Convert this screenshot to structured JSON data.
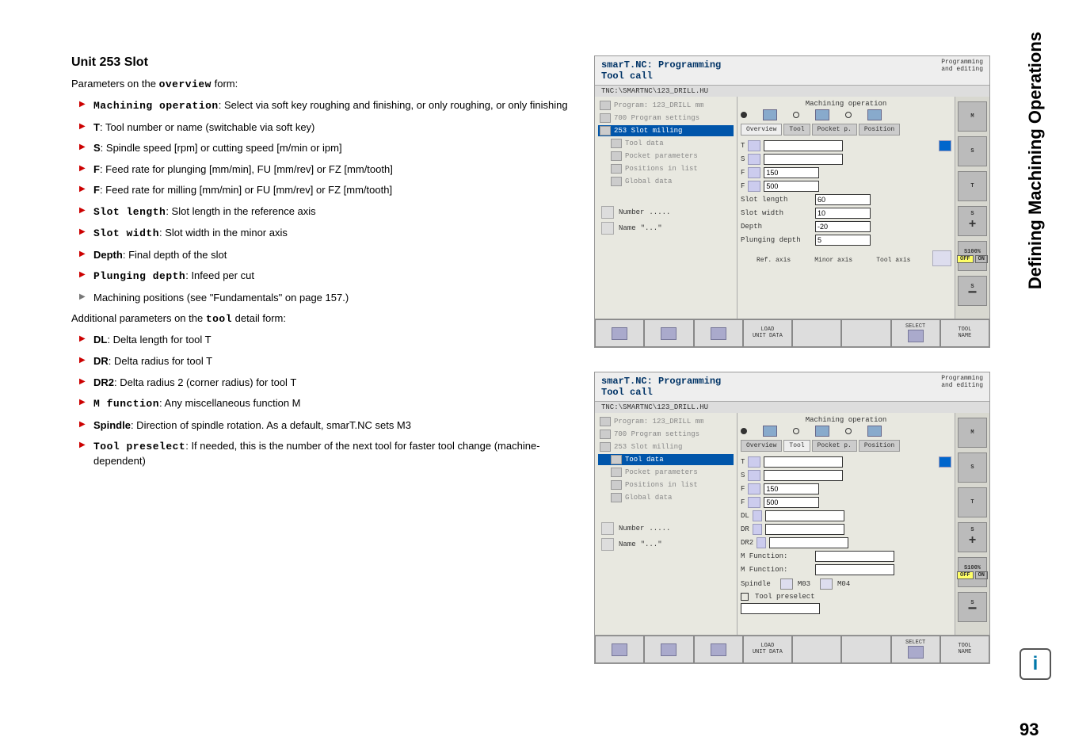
{
  "side_title": "Defining Machining Operations",
  "page_number": "93",
  "heading": "Unit 253 Slot",
  "intro_prefix": "Parameters on the ",
  "intro_bold": "overview",
  "intro_suffix": " form:",
  "params_overview": [
    {
      "bold": "Machining operation",
      "text": ": Select via soft key roughing and finishing, or only roughing, or only finishing",
      "mono": true
    },
    {
      "bold": "T",
      "text": ": Tool number or name (switchable via soft key)"
    },
    {
      "bold": "S",
      "text": ": Spindle speed [rpm] or cutting speed [m/min or ipm]"
    },
    {
      "bold": "F",
      "text": ": Feed rate for plunging [mm/min], FU [mm/rev] or FZ [mm/tooth]"
    },
    {
      "bold": "F",
      "text": ": Feed rate for milling [mm/min] or FU [mm/rev] or FZ [mm/tooth]"
    },
    {
      "bold": "Slot length",
      "text": ": Slot length in the reference axis",
      "mono": true
    },
    {
      "bold": "Slot width",
      "text": ": Slot width in the minor axis",
      "mono": true
    },
    {
      "bold": "Depth",
      "text": ": Final depth of the slot"
    },
    {
      "bold": "Plunging depth",
      "text": ": Infeed per cut",
      "mono": true
    }
  ],
  "param_machining_positions": "Machining positions (see \"Fundamentals\" on page 157.)",
  "intro2_prefix": "Additional parameters on the ",
  "intro2_bold": "tool",
  "intro2_suffix": " detail form:",
  "params_tool": [
    {
      "bold": "DL",
      "text": ": Delta length for tool T"
    },
    {
      "bold": "DR",
      "text": ": Delta radius for tool T"
    },
    {
      "bold": "DR2",
      "text": ": Delta radius 2 (corner radius) for tool T"
    },
    {
      "bold": "M function",
      "text": ": Any miscellaneous function M",
      "mono": true
    },
    {
      "bold": "Spindle",
      "text": ": Direction of spindle rotation. As a default, smarT.NC sets M3"
    },
    {
      "bold": "Tool preselect",
      "text": ": If needed, this is the number of the next tool for faster tool change (machine-dependent)",
      "mono": true
    }
  ],
  "cnc": {
    "title_main": "smarT.NC: Programming",
    "title_sub": "Tool call",
    "mode_line1": "Programming",
    "mode_line2": "and editing",
    "path": "TNC:\\SMARTNC\\123_DRILL.HU",
    "tree": {
      "items": [
        {
          "lvl": 0,
          "label": "Program: 123_DRILL mm"
        },
        {
          "lvl": 0,
          "label": "700 Program settings"
        },
        {
          "lvl": 0,
          "label": "253 Slot milling"
        },
        {
          "lvl": 1,
          "label": "Tool data"
        },
        {
          "lvl": 1,
          "label": "Pocket parameters"
        },
        {
          "lvl": 1,
          "label": "Positions in list"
        },
        {
          "lvl": 1,
          "label": "Global data"
        }
      ],
      "number_label": "Number",
      "number_val": ".....",
      "name_label": "Name",
      "name_val": "\"...\""
    },
    "main": {
      "machining_op": "Machining operation",
      "tabs": [
        "Overview",
        "Tool",
        "Pocket p.",
        "Position"
      ],
      "fields1": {
        "T": "T",
        "S": "S",
        "F1": "F",
        "F1_val": "150",
        "F2": "F",
        "F2_val": "500",
        "slot_length": "Slot length",
        "slot_length_val": "60",
        "slot_width": "Slot width",
        "slot_width_val": "10",
        "depth": "Depth",
        "depth_val": "-20",
        "plunging": "Plunging depth",
        "plunging_val": "5",
        "ref_axis": "Ref. axis",
        "minor_axis": "Minor axis",
        "tool_axis": "Tool axis"
      },
      "fields2": {
        "T": "T",
        "S": "S",
        "F1": "F",
        "F1_val": "150",
        "F2": "F",
        "F2_val": "500",
        "DL": "DL",
        "DR": "DR",
        "DR2": "DR2",
        "mfunc": "M Function:",
        "spindle": "Spindle",
        "m03": "M03",
        "m04": "M04",
        "tool_preselect": "Tool preselect"
      }
    },
    "side_btns": {
      "M": "M",
      "S": "S",
      "T": "T",
      "SF": "S",
      "s100": "S100%",
      "OFF": "OFF",
      "ON": "ON"
    },
    "soft": {
      "load": "LOAD",
      "unit_data": "UNIT DATA",
      "select": "SELECT",
      "tool": "TOOL",
      "name": "NAME"
    }
  }
}
